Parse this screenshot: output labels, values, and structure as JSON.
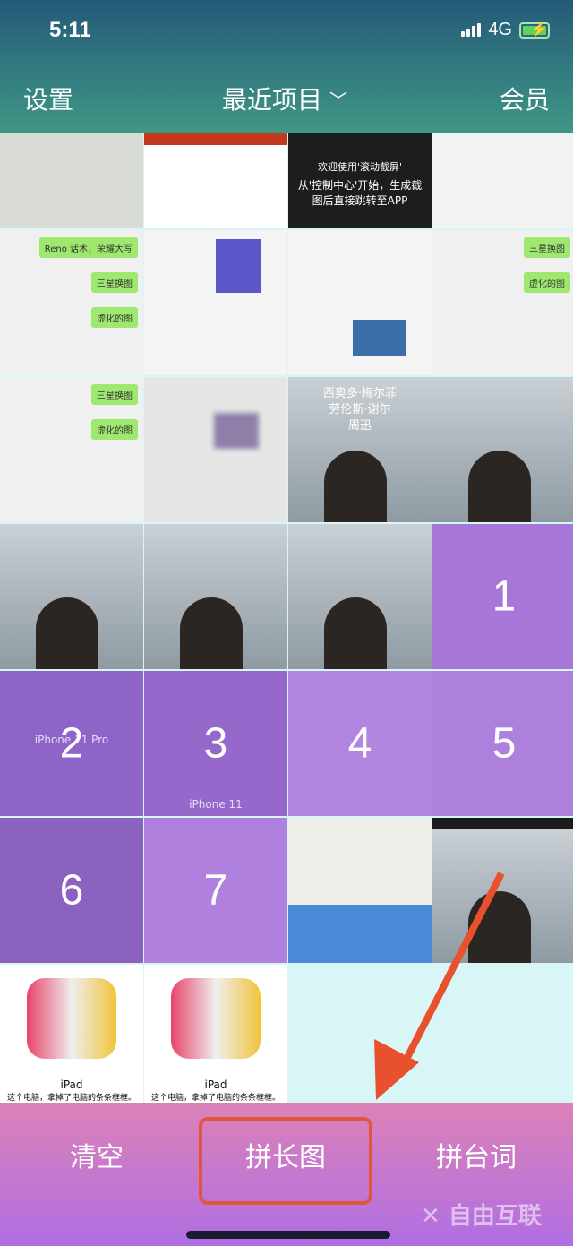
{
  "status_bar": {
    "time": "5:11",
    "network": "4G",
    "icons": [
      "signal-icon",
      "battery-charging-icon"
    ]
  },
  "header": {
    "left": "设置",
    "title": "最近项目",
    "right": "会员",
    "title_icon": "chevron-down-icon"
  },
  "tiles": {
    "welcome_title": "欢迎使用'滚动截屏'",
    "welcome_body": "从'控制中心'开始，生成截图后直接跳转至APP",
    "chat1": "Reno 话术，荣耀大写",
    "chat2": "三星换图",
    "chat3": "虚化的图",
    "poster_line1": "西奥多·梅尔菲",
    "poster_line2": "劳伦斯·谢尔",
    "poster_line3": "周迅",
    "iphone11pro": "iPhone 11 Pro",
    "iphone11": "iPhone 11",
    "ipad": "iPad",
    "ipad_sub": "这个电脑，拿掉了电脑的条条框框。",
    "selection_numbers": [
      "1",
      "2",
      "3",
      "4",
      "5",
      "6",
      "7"
    ]
  },
  "bottom": {
    "clear": "清空",
    "long_image": "拼长图",
    "lines": "拼台词",
    "watermark": "自由互联"
  },
  "colors": {
    "header_top": "#245a78",
    "header_bottom": "#3f9786",
    "selection": "#a676d8",
    "highlight": "#e0553e",
    "bottom_top": "#dc82b8",
    "bottom_bottom": "#b06ee2"
  }
}
